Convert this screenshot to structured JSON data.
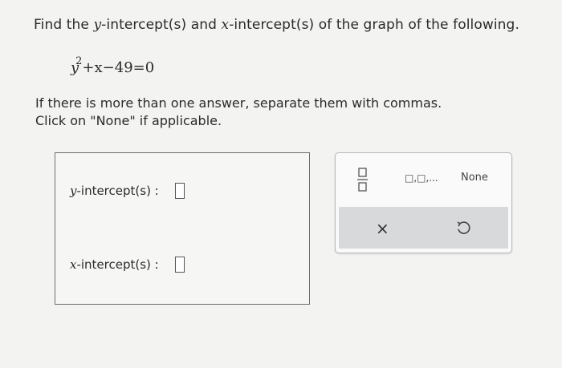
{
  "question": {
    "prefix": "Find the ",
    "var_y": "y",
    "middle": "-intercept(s) and ",
    "var_x": "x",
    "suffix": "-intercept(s) of the graph of the following."
  },
  "equation": {
    "base": "y",
    "exponent": "2",
    "rest": "+x−49=0"
  },
  "instructions": {
    "line1": "If there is more than one answer, separate them with commas.",
    "line2": "Click on \"None\" if applicable."
  },
  "answers": {
    "y_var": "y",
    "y_label": "-intercept(s) :",
    "x_var": "x",
    "x_label": "-intercept(s) :"
  },
  "keypad": {
    "none_label": "None",
    "comma_label": "□,□,...",
    "clear_symbol": "×"
  }
}
